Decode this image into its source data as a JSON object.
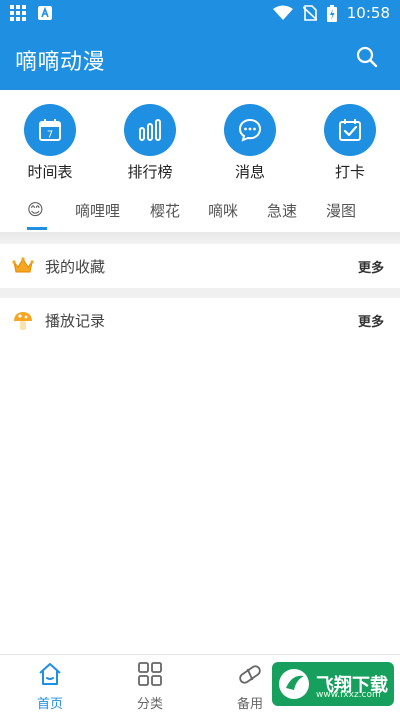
{
  "status_bar": {
    "time": "10:58",
    "icons": [
      "grid-icon",
      "a-letter-icon",
      "wifi-icon",
      "no-sim-icon",
      "battery-icon"
    ]
  },
  "app_bar": {
    "title": "嘀嘀动漫"
  },
  "quick_actions": [
    {
      "label": "时间表",
      "icon": "calendar-icon",
      "icon_text": "7"
    },
    {
      "label": "排行榜",
      "icon": "bars-icon"
    },
    {
      "label": "消息",
      "icon": "chat-icon"
    },
    {
      "label": "打卡",
      "icon": "checkin-icon"
    }
  ],
  "tabs": [
    {
      "label": "😊",
      "active": true
    },
    {
      "label": "嘀哩哩"
    },
    {
      "label": "樱花"
    },
    {
      "label": "嘀咪"
    },
    {
      "label": "急速"
    },
    {
      "label": "漫图"
    }
  ],
  "sections": [
    {
      "label": "我的收藏",
      "more": "更多",
      "icon": "crown-icon"
    },
    {
      "label": "播放记录",
      "more": "更多",
      "icon": "mushroom-icon"
    }
  ],
  "bottom_nav": [
    {
      "label": "首页",
      "icon": "home-icon",
      "active": true
    },
    {
      "label": "分类",
      "icon": "category-icon"
    },
    {
      "label": "备用",
      "icon": "capsule-icon"
    }
  ],
  "watermark": {
    "text": "飞翔下载",
    "sub": "www.fxxz.com"
  },
  "colors": {
    "primary": "#1e8fe1"
  }
}
